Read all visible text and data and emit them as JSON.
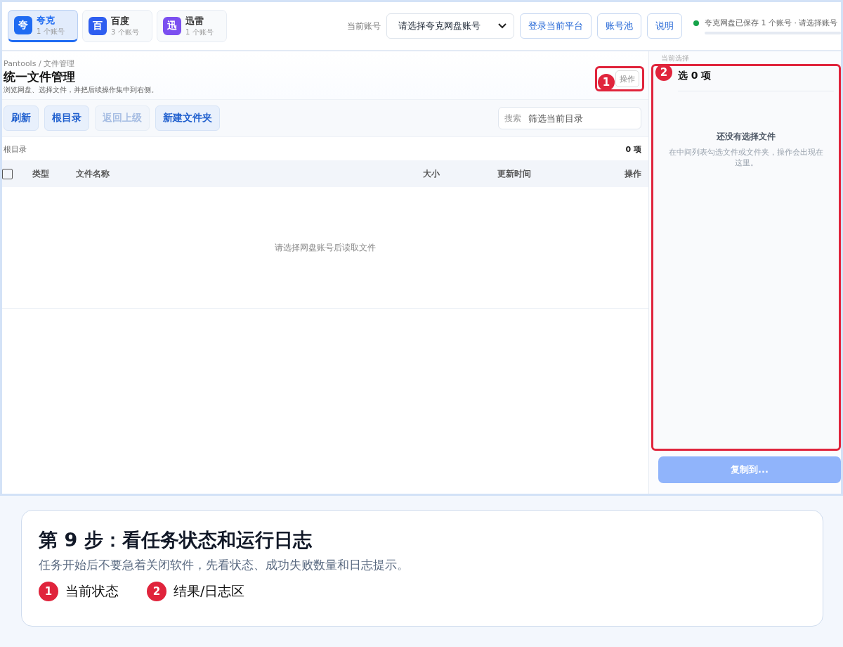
{
  "platform_tabs": [
    {
      "icon": "夸",
      "name": "夸克",
      "count": "1 个账号",
      "color": "#1f6bf2",
      "selected": true
    },
    {
      "icon": "百",
      "name": "百度",
      "count": "3 个账号",
      "color": "#2e5ef0",
      "selected": false
    },
    {
      "icon": "迅",
      "name": "迅雷",
      "count": "1 个账号",
      "color": "#7b4ff0",
      "selected": false
    }
  ],
  "account": {
    "label": "当前账号",
    "value": "请选择夸克网盘账号"
  },
  "top_buttons": [
    "登录当前平台",
    "账号池",
    "说明"
  ],
  "status": {
    "color": "#16a34a",
    "text": "夸克网盘已保存 1 个账号 · 请选择账号"
  },
  "header": {
    "breadcrumb": "Pantools / 文件管理",
    "title": "统一文件管理",
    "subtitle": "浏览网盘、选择文件，并把后续操作集中到右侧。",
    "action": "操作",
    "marker": "1"
  },
  "toolbar": [
    {
      "label": "刷新",
      "disabled": false
    },
    {
      "label": "根目录",
      "disabled": false
    },
    {
      "label": "返回上级",
      "disabled": true
    },
    {
      "label": "新建文件夹",
      "disabled": false
    }
  ],
  "search": {
    "label": "搜索",
    "placeholder": "筛选当前目录"
  },
  "path": {
    "text": "根目录",
    "count": "0 项"
  },
  "table": {
    "columns": [
      "类型",
      "文件名称",
      "大小",
      "更新时间",
      "操作"
    ],
    "select_all": false,
    "empty": "请选择网盘账号后读取文件"
  },
  "selection": {
    "label": "当前选择",
    "title": "选 0 项",
    "marker": "2",
    "empty_title": "还没有选择文件",
    "empty_text": "在中间列表勾选文件或文件夹，操作会出现在这里。",
    "button": "复制到...",
    "button_disabled": true
  },
  "caption": {
    "title": "第 9 步：看任务状态和运行日志",
    "subtitle": "任务开始后不要急着关闭软件，先看状态、成功失败数量和日志提示。",
    "legend": [
      {
        "number": "1",
        "label": "当前状态"
      },
      {
        "number": "2",
        "label": "结果/日志区"
      }
    ]
  }
}
